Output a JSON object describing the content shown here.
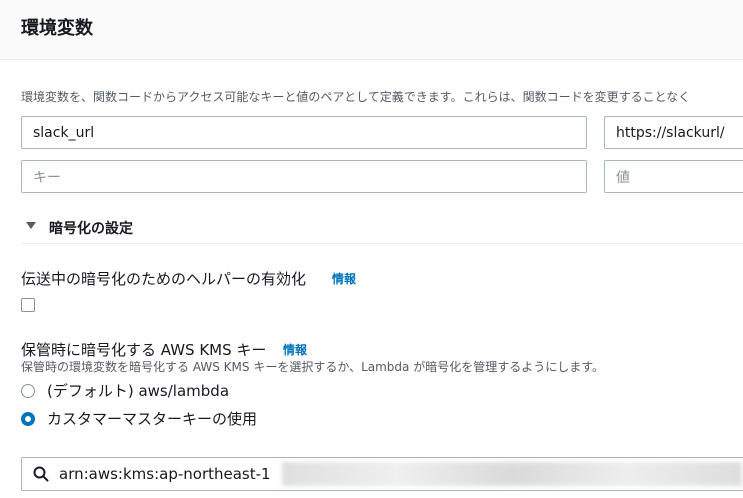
{
  "header": {
    "title": "環境変数"
  },
  "description": "環境変数を、関数コードからアクセス可能なキーと値のペアとして定義できます。これらは、関数コードを変更することなく",
  "env_vars": [
    {
      "key": "slack_url",
      "value": "https://slackurl/"
    }
  ],
  "new_var": {
    "key_placeholder": "キー",
    "value_placeholder": "値"
  },
  "encryption": {
    "section_title": "暗号化の設定",
    "transit": {
      "label": "伝送中の暗号化のためのヘルパーの有効化",
      "info": "情報",
      "checked": false
    },
    "at_rest": {
      "label": "保管時に暗号化する AWS KMS キー",
      "info": "情報",
      "description": "保管時の環境変数を暗号化する AWS KMS キーを選択するか、Lambda が暗号化を管理するようにします。",
      "options": [
        {
          "label": "(デフォルト) aws/lambda",
          "selected": false
        },
        {
          "label": "カスタマーマスターキーの使用",
          "selected": true
        }
      ]
    },
    "kms_search": {
      "value": "arn:aws:kms:ap-northeast-1"
    }
  },
  "colors": {
    "accent": "#0073bb",
    "text": "#16191f",
    "muted": "#545b64",
    "border": "#aab7b8"
  }
}
